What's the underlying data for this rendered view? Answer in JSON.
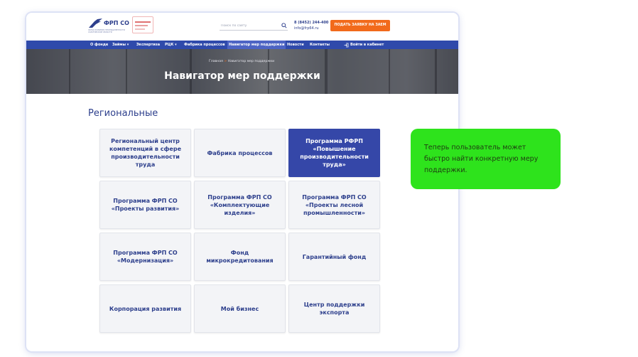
{
  "header": {
    "logo_title": "ФРП СО",
    "logo_subtitle": "ФОНД РАЗВИТИЯ ПРОМЫШЛЕННОСТИ САРАТОВСКОЙ ОБЛАСТИ",
    "search_placeholder": "Поиск по сайту",
    "phone": "8 (8452) 244-400",
    "email": "info@frp64.ru",
    "cta_label": "ПОДАТЬ ЗАЯВКУ НА ЗАЕМ"
  },
  "nav": {
    "items": [
      {
        "label": "О фонде"
      },
      {
        "label": "Займы ▾"
      },
      {
        "label": "Экспертиза"
      },
      {
        "label": "РЦК ▾"
      },
      {
        "label": "Фабрика процессов"
      },
      {
        "label": "Навигатор мер поддержки"
      },
      {
        "label": "Новости"
      },
      {
        "label": "Контакты"
      }
    ],
    "active_index": 5,
    "login_label": "Войти в кабинет"
  },
  "hero": {
    "breadcrumb_home": "Главная",
    "breadcrumb_sep": ">",
    "breadcrumb_current": "Навигатор мер поддержки",
    "title": "Навигатор мер поддержки"
  },
  "main": {
    "section_title": "Региональные",
    "cards": [
      {
        "label": "Региональный центр компетенций в сфере производительности труда"
      },
      {
        "label": "Фабрика процессов"
      },
      {
        "label": "Программа РФРП «Повышение производительности труда»"
      },
      {
        "label": "Программа ФРП СО «Проекты развития»"
      },
      {
        "label": "Программа ФРП СО «Комплектующие изделия»"
      },
      {
        "label": "Программа ФРП СО «Проекты лесной промышленности»"
      },
      {
        "label": "Программа ФРП СО «Модернизация»"
      },
      {
        "label": "Фонд микрокредитования"
      },
      {
        "label": "Гарантийный фонд"
      },
      {
        "label": "Корпорация развития"
      },
      {
        "label": "Мой бизнес"
      },
      {
        "label": "Центр поддержки экспорта"
      }
    ],
    "active_card_index": 2
  },
  "callout": {
    "text": "Теперь пользователь может быстро найти конкретную меру поддержки."
  },
  "colors": {
    "brand_blue": "#2f4aab",
    "active_card": "#3547a8",
    "cta_orange": "#f26a1b",
    "callout_green": "#2ee31c"
  },
  "icons": {
    "search": "search-icon",
    "login": "login-icon",
    "logo": "eagle-logo-icon"
  }
}
